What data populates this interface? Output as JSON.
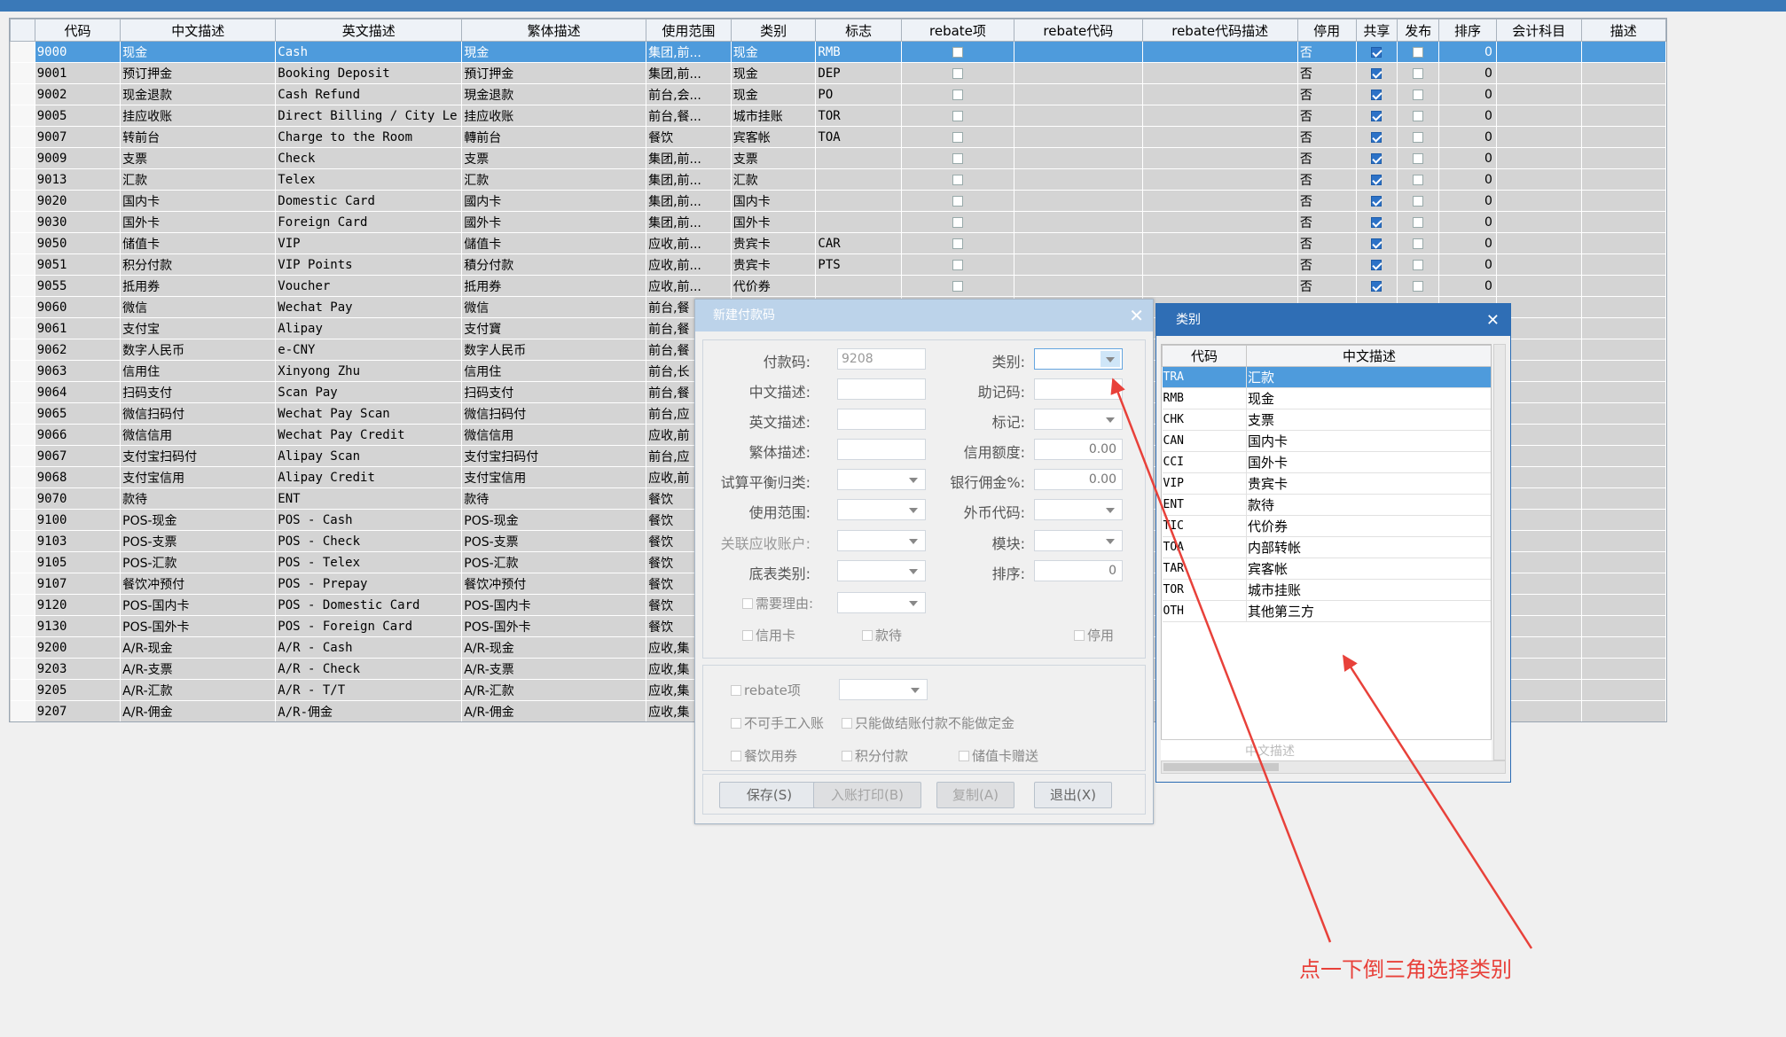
{
  "grid": {
    "columns": [
      "代码",
      "中文描述",
      "英文描述",
      "繁体描述",
      "使用范围",
      "类别",
      "标志",
      "rebate项",
      "rebate代码",
      "rebate代码描述",
      "停用",
      "共享",
      "发布",
      "排序",
      "会计科目",
      "描述"
    ],
    "rows": [
      {
        "code": "9000",
        "cn": "现金",
        "en": "Cash",
        "tw": "現金",
        "scope": "集团,前...",
        "cat": "现金",
        "flag": "RMB",
        "stop": "否",
        "share": true,
        "pub": false,
        "sort": "0",
        "sel": true
      },
      {
        "code": "9001",
        "cn": "预订押金",
        "en": "Booking Deposit",
        "tw": "預订押金",
        "scope": "集团,前...",
        "cat": "现金",
        "flag": "DEP",
        "stop": "否",
        "share": true,
        "pub": false,
        "sort": "0"
      },
      {
        "code": "9002",
        "cn": "现金退款",
        "en": "Cash Refund",
        "tw": "現金退款",
        "scope": "前台,会...",
        "cat": "现金",
        "flag": "PO",
        "stop": "否",
        "share": true,
        "pub": false,
        "sort": "0"
      },
      {
        "code": "9005",
        "cn": "挂应收账",
        "en": "Direct Billing / City Le",
        "tw": "挂应收账",
        "scope": "前台,餐...",
        "cat": "城市挂账",
        "flag": "TOR",
        "stop": "否",
        "share": true,
        "pub": false,
        "sort": "0"
      },
      {
        "code": "9007",
        "cn": "转前台",
        "en": "Charge to the Room",
        "tw": "轉前台",
        "scope": "餐饮",
        "cat": "宾客帐",
        "flag": "TOA",
        "stop": "否",
        "share": true,
        "pub": false,
        "sort": "0"
      },
      {
        "code": "9009",
        "cn": "支票",
        "en": "Check",
        "tw": "支票",
        "scope": "集团,前...",
        "cat": "支票",
        "flag": "",
        "stop": "否",
        "share": true,
        "pub": false,
        "sort": "0"
      },
      {
        "code": "9013",
        "cn": "汇款",
        "en": "Telex",
        "tw": "汇款",
        "scope": "集团,前...",
        "cat": "汇款",
        "flag": "",
        "stop": "否",
        "share": true,
        "pub": false,
        "sort": "0"
      },
      {
        "code": "9020",
        "cn": "国内卡",
        "en": "Domestic Card",
        "tw": "國内卡",
        "scope": "集团,前...",
        "cat": "国内卡",
        "flag": "",
        "stop": "否",
        "share": true,
        "pub": false,
        "sort": "0"
      },
      {
        "code": "9030",
        "cn": "国外卡",
        "en": "Foreign Card",
        "tw": "國外卡",
        "scope": "集团,前...",
        "cat": "国外卡",
        "flag": "",
        "stop": "否",
        "share": true,
        "pub": false,
        "sort": "0"
      },
      {
        "code": "9050",
        "cn": "储值卡",
        "en": "VIP",
        "tw": "儲值卡",
        "scope": "应收,前...",
        "cat": "贵宾卡",
        "flag": "CAR",
        "stop": "否",
        "share": true,
        "pub": false,
        "sort": "0"
      },
      {
        "code": "9051",
        "cn": "积分付款",
        "en": "VIP Points",
        "tw": "積分付款",
        "scope": "应收,前...",
        "cat": "贵宾卡",
        "flag": "PTS",
        "stop": "否",
        "share": true,
        "pub": false,
        "sort": "0"
      },
      {
        "code": "9055",
        "cn": "抵用券",
        "en": "Voucher",
        "tw": "抵用券",
        "scope": "应收,前...",
        "cat": "代价券",
        "flag": "",
        "stop": "否",
        "share": true,
        "pub": false,
        "sort": "0"
      },
      {
        "code": "9060",
        "cn": "微信",
        "en": "Wechat Pay",
        "tw": "微信",
        "scope": "前台,餐"
      },
      {
        "code": "9061",
        "cn": "支付宝",
        "en": "Alipay",
        "tw": "支付寶",
        "scope": "前台,餐"
      },
      {
        "code": "9062",
        "cn": "数字人民币",
        "en": "e-CNY",
        "tw": "数字人民币",
        "scope": "前台,餐"
      },
      {
        "code": "9063",
        "cn": "信用住",
        "en": "Xinyong Zhu",
        "tw": "信用住",
        "scope": "前台,长"
      },
      {
        "code": "9064",
        "cn": "扫码支付",
        "en": "Scan Pay",
        "tw": "扫码支付",
        "scope": "前台,餐"
      },
      {
        "code": "9065",
        "cn": "微信扫码付",
        "en": "Wechat Pay Scan",
        "tw": "微信扫码付",
        "scope": "前台,应"
      },
      {
        "code": "9066",
        "cn": "微信信用",
        "en": "Wechat Pay Credit",
        "tw": "微信信用",
        "scope": "应收,前"
      },
      {
        "code": "9067",
        "cn": "支付宝扫码付",
        "en": "Alipay Scan",
        "tw": "支付宝扫码付",
        "scope": "前台,应"
      },
      {
        "code": "9068",
        "cn": "支付宝信用",
        "en": "Alipay Credit",
        "tw": "支付宝信用",
        "scope": "应收,前"
      },
      {
        "code": "9070",
        "cn": "款待",
        "en": "ENT",
        "tw": "款待",
        "scope": "餐饮"
      },
      {
        "code": "9100",
        "cn": "POS-现金",
        "en": "POS - Cash",
        "tw": "POS-现金",
        "scope": "餐饮"
      },
      {
        "code": "9103",
        "cn": "POS-支票",
        "en": "POS - Check",
        "tw": "POS-支票",
        "scope": "餐饮"
      },
      {
        "code": "9105",
        "cn": "POS-汇款",
        "en": "POS - Telex",
        "tw": "POS-汇款",
        "scope": "餐饮"
      },
      {
        "code": "9107",
        "cn": "餐饮冲预付",
        "en": "POS - Prepay",
        "tw": "餐饮冲预付",
        "scope": "餐饮"
      },
      {
        "code": "9120",
        "cn": "POS-国内卡",
        "en": "POS - Domestic Card",
        "tw": "POS-国内卡",
        "scope": "餐饮"
      },
      {
        "code": "9130",
        "cn": "POS-国外卡",
        "en": "POS - Foreign Card",
        "tw": "POS-国外卡",
        "scope": "餐饮"
      },
      {
        "code": "9200",
        "cn": "A/R-现金",
        "en": "A/R - Cash",
        "tw": "A/R-现金",
        "scope": "应收,集"
      },
      {
        "code": "9203",
        "cn": "A/R-支票",
        "en": "A/R - Check",
        "tw": "A/R-支票",
        "scope": "应收,集"
      },
      {
        "code": "9205",
        "cn": "A/R-汇款",
        "en": "A/R - T/T",
        "tw": "A/R-汇款",
        "scope": "应收,集"
      },
      {
        "code": "9207",
        "cn": "A/R-佣金",
        "en": "A/R-佣金",
        "tw": "A/R-佣金",
        "scope": "应收,集"
      }
    ]
  },
  "dialog": {
    "title": "新建付款码",
    "labels": {
      "code": "付款码:",
      "cat": "类别:",
      "cn": "中文描述:",
      "memo": "助记码:",
      "en": "英文描述:",
      "flag": "标记:",
      "tw": "繁体描述:",
      "credit": "信用额度:",
      "trial": "试算平衡归类:",
      "bank": "银行佣金%:",
      "scope": "使用范围:",
      "fx": "外币代码:",
      "ar": "关联应收账户:",
      "module": "模块:",
      "bottom": "底表类别:",
      "sort": "排序:",
      "reason": "需要理由:"
    },
    "values": {
      "code": "9208",
      "credit": "0.00",
      "bank": "0.00",
      "sort": "0"
    },
    "checks": {
      "card": "信用卡",
      "ent": "款待",
      "stop": "停用",
      "rebate": "rebate项",
      "nomanual": "不可手工入账",
      "onlysettle": "只能做结账付款不能做定金",
      "meal": "餐饮用券",
      "points": "积分付款",
      "stored": "储值卡赠送"
    },
    "buttons": {
      "save": "保存(S)",
      "print": "入账打印(B)",
      "copy": "复制(A)",
      "exit": "退出(X)"
    }
  },
  "popup": {
    "title": "类别",
    "columns": [
      "代码",
      "中文描述"
    ],
    "rows": [
      {
        "code": "TRA",
        "name": "汇款",
        "sel": true
      },
      {
        "code": "RMB",
        "name": "现金"
      },
      {
        "code": "CHK",
        "name": "支票"
      },
      {
        "code": "CAN",
        "name": "国内卡"
      },
      {
        "code": "CCI",
        "name": "国外卡"
      },
      {
        "code": "VIP",
        "name": "贵宾卡"
      },
      {
        "code": "ENT",
        "name": "款待"
      },
      {
        "code": "TIC",
        "name": "代价券"
      },
      {
        "code": "TOA",
        "name": "内部转帐"
      },
      {
        "code": "TAR",
        "name": "宾客帐"
      },
      {
        "code": "TOR",
        "name": "城市挂账"
      },
      {
        "code": "OTH",
        "name": "其他第三方"
      }
    ],
    "filter_placeholder": "中文描述"
  },
  "annotation": {
    "text": "点一下倒三角选择类别",
    "color": "#e8413a"
  }
}
